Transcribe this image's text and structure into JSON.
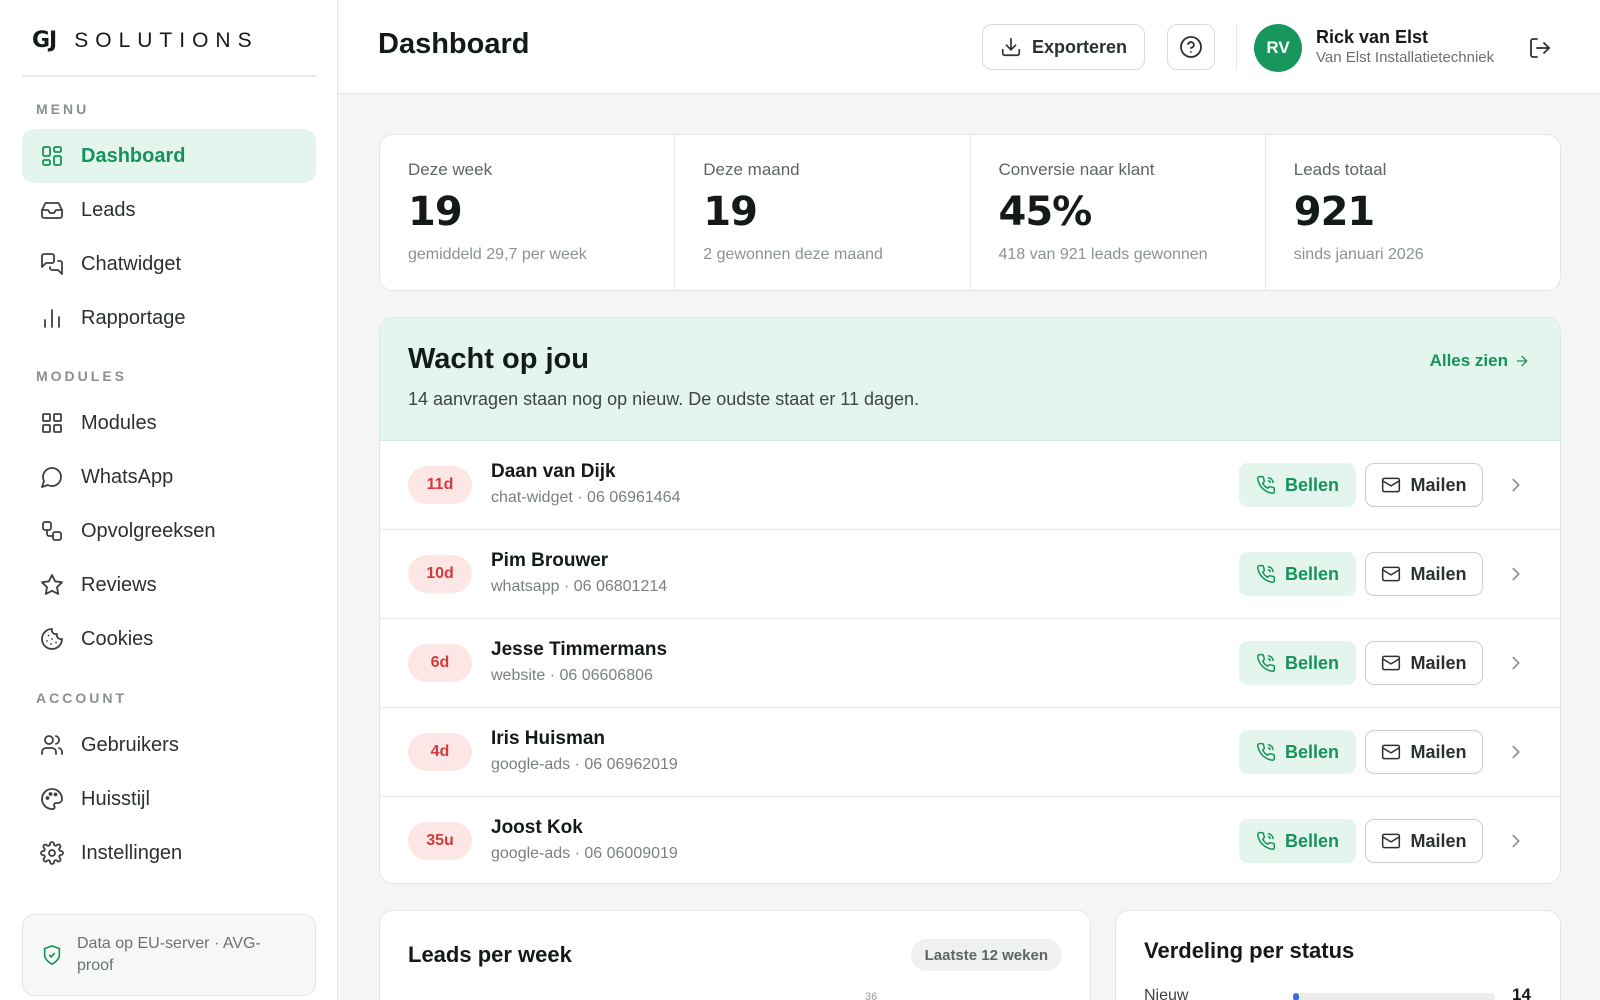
{
  "brand": {
    "logo_mark": "GJ",
    "logo_text": "SOLUTIONS"
  },
  "sidebar": {
    "sections": [
      {
        "label": "MENU",
        "items": [
          {
            "label": "Dashboard",
            "icon": "layout-grid-icon",
            "active": true
          },
          {
            "label": "Leads",
            "icon": "inbox-icon"
          },
          {
            "label": "Chatwidget",
            "icon": "chat-bubbles-icon"
          },
          {
            "label": "Rapportage",
            "icon": "bar-chart-icon"
          }
        ]
      },
      {
        "label": "MODULES",
        "items": [
          {
            "label": "Modules",
            "icon": "grid-icon"
          },
          {
            "label": "WhatsApp",
            "icon": "message-circle-icon"
          },
          {
            "label": "Opvolgreeksen",
            "icon": "workflow-icon"
          },
          {
            "label": "Reviews",
            "icon": "star-icon"
          },
          {
            "label": "Cookies",
            "icon": "cookie-icon"
          }
        ]
      },
      {
        "label": "ACCOUNT",
        "items": [
          {
            "label": "Gebruikers",
            "icon": "users-icon"
          },
          {
            "label": "Huisstijl",
            "icon": "palette-icon"
          },
          {
            "label": "Instellingen",
            "icon": "settings-icon"
          }
        ]
      }
    ],
    "footer_note": "Data op EU-server · AVG-proof"
  },
  "header": {
    "title": "Dashboard",
    "export_label": "Exporteren",
    "user": {
      "initials": "RV",
      "name": "Rick van Elst",
      "company": "Van Elst Installatietechniek"
    }
  },
  "stats": [
    {
      "label": "Deze week",
      "value": "19",
      "sub": "gemiddeld 29,7 per week"
    },
    {
      "label": "Deze maand",
      "value": "19",
      "sub": "2 gewonnen deze maand"
    },
    {
      "label": "Conversie naar klant",
      "value": "45%",
      "sub": "418 van 921 leads gewonnen"
    },
    {
      "label": "Leads totaal",
      "value": "921",
      "sub": "sinds januari 2026"
    }
  ],
  "waiting": {
    "title": "Wacht op jou",
    "subtitle": "14 aanvragen staan nog op nieuw. De oudste staat er 11 dagen.",
    "see_all": "Alles zien",
    "call_label": "Bellen",
    "mail_label": "Mailen",
    "leads": [
      {
        "age": "11d",
        "name": "Daan van Dijk",
        "meta": "chat-widget · 06 06961464"
      },
      {
        "age": "10d",
        "name": "Pim Brouwer",
        "meta": "whatsapp · 06 06801214"
      },
      {
        "age": "6d",
        "name": "Jesse Timmermans",
        "meta": "website · 06 06606806"
      },
      {
        "age": "4d",
        "name": "Iris Huisman",
        "meta": "google-ads · 06 06962019"
      },
      {
        "age": "35u",
        "name": "Joost Kok",
        "meta": "google-ads · 06 06009019"
      }
    ]
  },
  "weekly": {
    "title": "Leads per week",
    "range": "Laatste 12 weken",
    "axis_tick": "36"
  },
  "status_card": {
    "title": "Verdeling per status",
    "items": [
      {
        "label": "Nieuw",
        "count": "14",
        "share": 0.03,
        "color": "#3b6fe0"
      }
    ]
  },
  "colors": {
    "accent": "#15935b",
    "accent_soft": "#e3f5ec",
    "danger": "#d23b3b"
  }
}
